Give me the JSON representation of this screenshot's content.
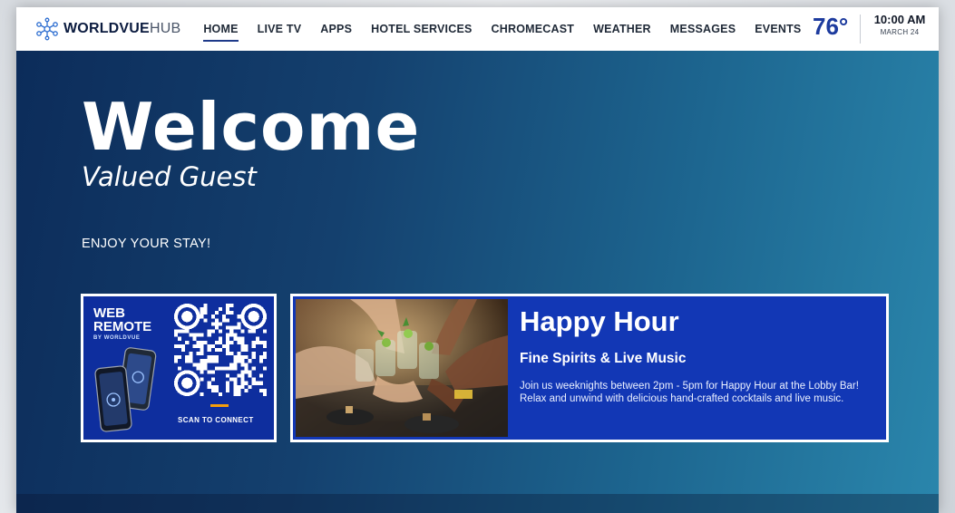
{
  "brand": {
    "name_bold": "WORLDVUE",
    "name_light": "HUB"
  },
  "nav": {
    "items": [
      {
        "label": "HOME",
        "active": true
      },
      {
        "label": "LIVE TV"
      },
      {
        "label": "APPS"
      },
      {
        "label": "HOTEL SERVICES"
      },
      {
        "label": "CHROMECAST"
      },
      {
        "label": "WEATHER"
      },
      {
        "label": "MESSAGES"
      },
      {
        "label": "EVENTS"
      }
    ]
  },
  "status": {
    "temperature": "76°",
    "time": "10:00 AM",
    "date": "MARCH 24"
  },
  "hero": {
    "title": "Welcome",
    "subtitle": "Valued Guest",
    "tagline": "ENJOY YOUR STAY!"
  },
  "remote_card": {
    "title_line1": "WEB",
    "title_line2": "REMOTE",
    "byline": "BY WORLDVUE",
    "cta": "SCAN TO CONNECT"
  },
  "promo": {
    "title": "Happy Hour",
    "subtitle": "Fine Spirits & Live Music",
    "description": "Join us weeknights between 2pm - 5pm for Happy Hour at the Lobby Bar! Relax and unwind with delicious hand-crafted cocktails and live music."
  },
  "colors": {
    "accent": "#1d3b9e",
    "hero_start": "#0c2c5a",
    "hero_end": "#2a86ac",
    "promo_bg": "#1237b5",
    "remote_bg": "#0e2e9e"
  }
}
